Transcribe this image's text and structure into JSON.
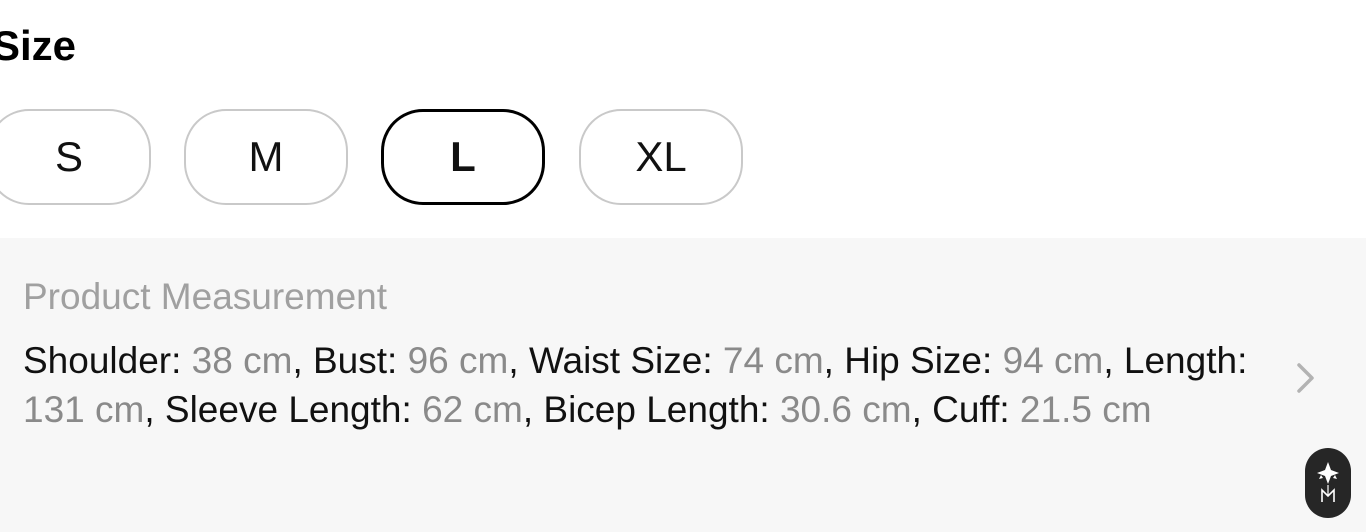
{
  "size_section": {
    "title": "Size",
    "options": [
      "S",
      "M",
      "L",
      "XL"
    ],
    "selected": "L"
  },
  "measurement": {
    "title": "Product Measurement",
    "items": [
      {
        "label": "Shoulder",
        "value": "38 cm"
      },
      {
        "label": "Bust",
        "value": "96 cm"
      },
      {
        "label": "Waist Size",
        "value": "74 cm"
      },
      {
        "label": "Hip Size",
        "value": "94 cm"
      },
      {
        "label": "Length",
        "value": "131 cm"
      },
      {
        "label": "Sleeve Length",
        "value": "62 cm"
      },
      {
        "label": "Bicep Length",
        "value": "30.6 cm"
      },
      {
        "label": "Cuff",
        "value": "21.5 cm"
      }
    ],
    "separator": ", ",
    "label_suffix": ": ",
    "chevron_icon": "chevron-right-icon"
  },
  "floating_button": {
    "icon": "brand-logo-icon"
  },
  "colors": {
    "page_background": "#ffffff",
    "panel_background": "#f7f7f7",
    "selected_border": "#000000",
    "unselected_border": "#c9c9c9",
    "muted_text": "#a0a0a0",
    "value_text": "#8a8a8a",
    "fab_background": "#262626"
  }
}
